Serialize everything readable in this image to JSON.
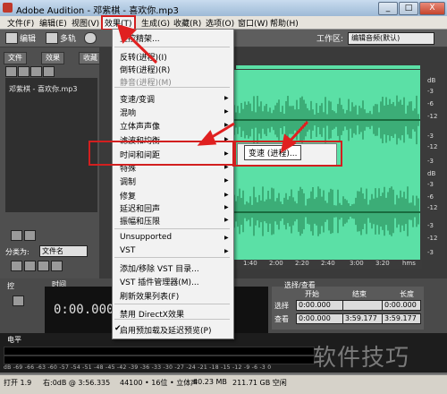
{
  "app": {
    "title": "Adobe Audition - 邓紫棋 - 喜欢你.mp3",
    "window_buttons": [
      "_",
      "□",
      "X"
    ]
  },
  "menubar": {
    "items": [
      "文件(F)",
      "编辑(E)",
      "视图(V)",
      "效果(T)",
      "生成(G)",
      "收藏(R)",
      "选项(O)",
      "窗口(W)",
      "帮助(H)"
    ]
  },
  "toolbar": {
    "edit_label": "编辑",
    "multitrack_label": "多轨",
    "workspace_label": "工作区:",
    "workspace_value": "编辑音频(默认)"
  },
  "left_panel": {
    "tabs": [
      "文件",
      "效果",
      "收藏"
    ],
    "file_item": "邓紫棋 - 喜欢你.mp3",
    "sort_label": "分类为:",
    "sort_value": "文件名"
  },
  "effects_menu": {
    "items": [
      {
        "label": "主控精架...",
        "disabled": false,
        "submenu": false
      },
      {
        "label": "反转(进程)(I)",
        "disabled": false,
        "submenu": false
      },
      {
        "label": "倒转(进程)(R)",
        "disabled": false,
        "submenu": false
      },
      {
        "label": "静音(进程)(M)",
        "disabled": true,
        "submenu": false
      },
      {
        "label": "变速/变调",
        "disabled": false,
        "submenu": true
      },
      {
        "label": "混响",
        "disabled": false,
        "submenu": true
      },
      {
        "label": "立体声声像",
        "disabled": false,
        "submenu": true
      },
      {
        "label": "滤波和均衡",
        "disabled": false,
        "submenu": true
      },
      {
        "label": "时间和间距",
        "disabled": false,
        "submenu": true
      },
      {
        "label": "特殊",
        "disabled": false,
        "submenu": true
      },
      {
        "label": "调制",
        "disabled": false,
        "submenu": true
      },
      {
        "label": "修复",
        "disabled": false,
        "submenu": true
      },
      {
        "label": "延迟和回声",
        "disabled": false,
        "submenu": true
      },
      {
        "label": "振幅和压限",
        "disabled": false,
        "submenu": true
      },
      {
        "label": "Unsupported",
        "disabled": false,
        "submenu": true
      },
      {
        "label": "VST",
        "disabled": false,
        "submenu": true
      },
      {
        "label": "添加/移除 VST 目录...",
        "disabled": false,
        "submenu": false
      },
      {
        "label": "VST 插件管理器(M)...",
        "disabled": false,
        "submenu": false
      },
      {
        "label": "刷新效果列表(F)",
        "disabled": false,
        "submenu": false
      },
      {
        "label": "禁用 DirectX效果",
        "disabled": false,
        "submenu": false
      },
      {
        "label": "启用预加载及延迟预览(P)",
        "disabled": false,
        "submenu": false,
        "checked": true
      }
    ],
    "submenu_item": "变速 (进程)..."
  },
  "waveform": {
    "db_labels": [
      "dB",
      "-3",
      "-6",
      "-12",
      "-3",
      "-12",
      "-3",
      "dB",
      "-3",
      "-6",
      "-12",
      "-3",
      "-12",
      "-3"
    ],
    "time_labels": [
      "1:40",
      "2:00",
      "2:20",
      "2:40",
      "3:00",
      "3:20",
      "hms"
    ],
    "color": "#5be0a6"
  },
  "transport": {
    "time_tab": "时间",
    "time_value": "0:00.000"
  },
  "selection": {
    "header": "选择/查看",
    "cols": [
      "开始",
      "结束",
      "长度"
    ],
    "rows": [
      {
        "label": "选择",
        "start": "0:00.000",
        "end": "",
        "length": "0:00.000"
      },
      {
        "label": "查看",
        "start": "0:00.000",
        "end": "3:59.177",
        "length": "3:59.177"
      }
    ]
  },
  "level": {
    "tab": "电平",
    "scale": "dB  -69  -66  -63  -60  -57  -54  -51  -48  -45  -42  -39  -36  -33  -30  -27  -24  -21  -18  -15  -12  -9  -6  -3  0"
  },
  "statusbar": {
    "items": [
      "打开 1.9",
      "右:0dB @ 3:56.335",
      "44100 • 16位 • 立体声",
      "40.23 MB",
      "211.71 GB 空闲"
    ]
  },
  "watermark": "软件技巧"
}
